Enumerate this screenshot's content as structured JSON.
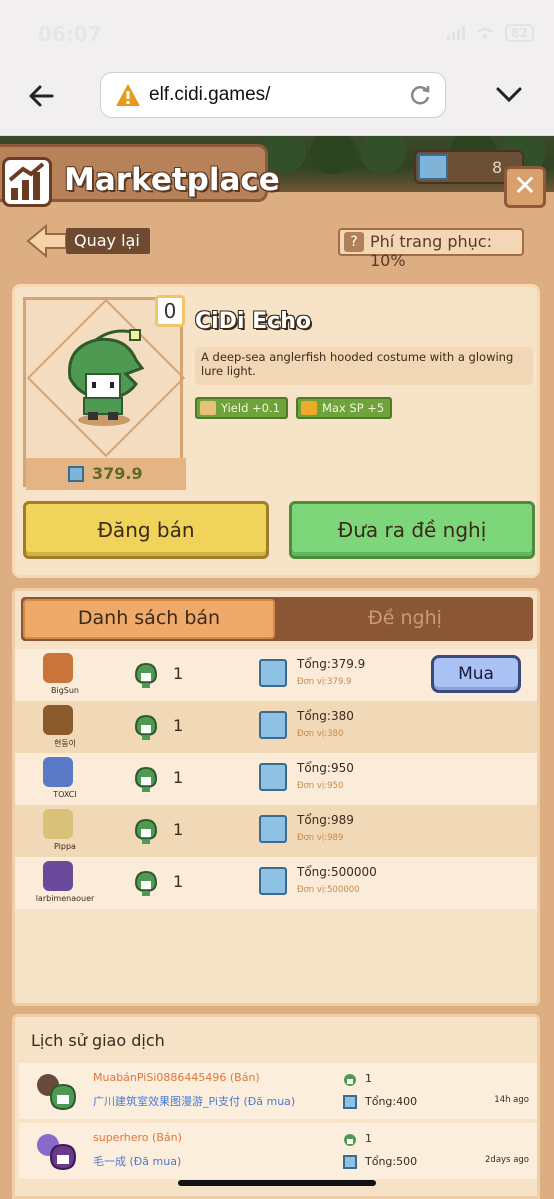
{
  "status": {
    "time": "06:07",
    "battery": "82"
  },
  "browser": {
    "url": "elf.cidi.games/"
  },
  "header": {
    "title": "Marketplace",
    "currency_value": "8"
  },
  "nav": {
    "back_label": "Quay lại",
    "fee_label": "Phí trang phục: 10%",
    "fee_icon": "?"
  },
  "item": {
    "quantity": "0",
    "price": "379.9",
    "name": "CiDi Echo",
    "description": "A deep-sea anglerfish hooded costume with a glowing lure light.",
    "stats": [
      {
        "label": "Yield +0.1",
        "icon": "scroll-icon"
      },
      {
        "label": "Max SP +5",
        "icon": "lightning-icon"
      }
    ],
    "sell_button": "Đăng bán",
    "offer_button": "Đưa ra đề nghị"
  },
  "tabs": {
    "active": "Danh sách bán",
    "inactive": "Đề nghị"
  },
  "listings": [
    {
      "user": "BigSun",
      "qty": "1",
      "total": "Tổng:379.9",
      "unit": "Đơn vị:379.9",
      "buy": "Mua",
      "avatar_color": "#c8743a"
    },
    {
      "user": "현동이",
      "qty": "1",
      "total": "Tổng:380",
      "unit": "Đơn vị:380",
      "avatar_color": "#8a5a2a"
    },
    {
      "user": "TOXCI",
      "qty": "1",
      "total": "Tổng:950",
      "unit": "Đơn vị:950",
      "avatar_color": "#5a7ac8"
    },
    {
      "user": "Pippa",
      "qty": "1",
      "total": "Tổng:989",
      "unit": "Đơn vị:989",
      "avatar_color": "#d8c27a"
    },
    {
      "user": "larbimenaouer",
      "qty": "1",
      "total": "Tổng:500000",
      "unit": "Đơn vị:500000",
      "avatar_color": "#6a4a9a"
    }
  ],
  "history": {
    "title": "Lịch sử giao dịch",
    "rows": [
      {
        "seller": "MuabánPiSi0886445496 (Bán)",
        "buyer": "广川建筑室效果图漫游_Pi支付 (Đã mua)",
        "qty": "1",
        "total": "Tổng:400",
        "time": "14h ago"
      },
      {
        "seller": "superhero (Bán)",
        "buyer": "毛一成 (Đã mua)",
        "qty": "1",
        "total": "Tổng:500",
        "time": "2days ago"
      }
    ]
  },
  "colors": {
    "panel": "#dcae82",
    "sell": "#f0d35a",
    "offer": "#7ed67a",
    "buy": "#a9c2f3"
  }
}
